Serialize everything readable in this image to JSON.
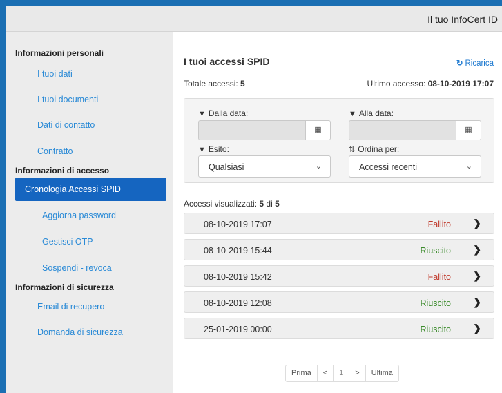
{
  "header": {
    "brand": "Il tuo InfoCert ID"
  },
  "sidebar": {
    "sections": [
      {
        "title": "Informazioni personali"
      },
      {
        "title": "Informazioni di accesso"
      },
      {
        "title": "Informazioni di sicurezza"
      }
    ],
    "items": [
      {
        "label": "I tuoi dati"
      },
      {
        "label": "I tuoi documenti"
      },
      {
        "label": "Dati di contatto"
      },
      {
        "label": "Contratto"
      },
      {
        "label": "Cronologia Accessi SPID",
        "active": true
      },
      {
        "label": "Aggiorna password"
      },
      {
        "label": "Gestisci OTP"
      },
      {
        "label": "Sospendi - revoca"
      },
      {
        "label": "Email di recupero"
      },
      {
        "label": "Domanda di sicurezza"
      }
    ]
  },
  "main": {
    "title": "I tuoi accessi SPID",
    "reload": "Ricarica",
    "totale_label": "Totale accessi:",
    "totale_value": "5",
    "ultimo_label": "Ultimo accesso:",
    "ultimo_value": "08-10-2019 17:07",
    "filters": {
      "from_label": "Dalla data:",
      "to_label": "Alla data:",
      "from_value": "",
      "to_value": "",
      "esito_label": "Esito:",
      "esito_value": "Qualsiasi",
      "order_label": "Ordina per:",
      "order_value": "Accessi recenti"
    },
    "count_label": "Accessi visualizzati:",
    "count_shown": "5",
    "count_of": "di",
    "count_total": "5",
    "rows": [
      {
        "date": "08-10-2019 17:07",
        "status": "Fallito"
      },
      {
        "date": "08-10-2019 15:44",
        "status": "Riuscito"
      },
      {
        "date": "08-10-2019 15:42",
        "status": "Fallito"
      },
      {
        "date": "08-10-2019 12:08",
        "status": "Riuscito"
      },
      {
        "date": "25-01-2019 00:00",
        "status": "Riuscito"
      }
    ],
    "pager": {
      "first": "Prima",
      "prev": "<",
      "current": "1",
      "next": ">",
      "last": "Ultima"
    }
  },
  "colors": {
    "accent": "#1565c0",
    "link": "#2a8ad6",
    "fail": "#c0392b",
    "success": "#3a8a2a",
    "frame": "#1b6fb3"
  },
  "icons": {
    "reload": "refresh-icon",
    "filter": "filter-icon",
    "calendar": "calendar-icon",
    "sort": "sort-icon",
    "chevron": "chevron-down-icon",
    "row": "chevron-right-icon"
  }
}
